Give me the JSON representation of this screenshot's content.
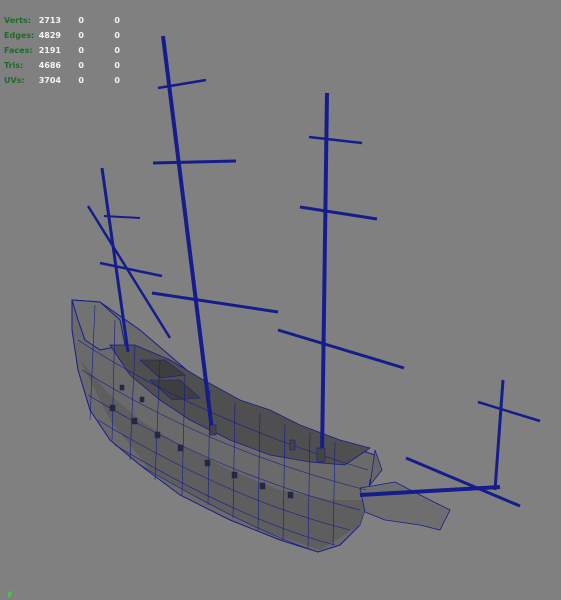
{
  "hud": {
    "rows": [
      {
        "label": "Verts:",
        "values": [
          "2713",
          "0",
          "0"
        ]
      },
      {
        "label": "Edges:",
        "values": [
          "4829",
          "0",
          "0"
        ]
      },
      {
        "label": "Faces:",
        "values": [
          "2191",
          "0",
          "0"
        ]
      },
      {
        "label": "Tris:",
        "values": [
          "4686",
          "0",
          "0"
        ]
      },
      {
        "label": "UVs:",
        "values": [
          "3704",
          "0",
          "0"
        ]
      }
    ]
  },
  "colors": {
    "viewport_bg": "#808080",
    "hud_label": "#1c6b2b",
    "hud_value": "#f4f4f4",
    "wireframe": "#151d8c",
    "hull_fill": "#6b6b6b",
    "axis": "#3fd44a"
  },
  "axis": {
    "label": "y"
  }
}
